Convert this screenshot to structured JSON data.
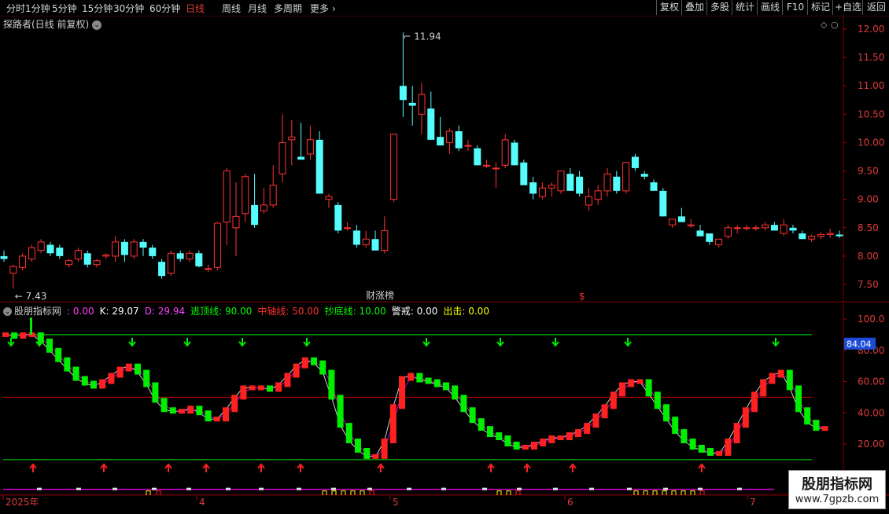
{
  "toolbar": {
    "periods": [
      "分时",
      "1分钟",
      "5分钟",
      "15分钟",
      "30分钟",
      "60分钟",
      "日线",
      "周线",
      "月线",
      "多周期",
      "更多"
    ],
    "active_period": "日线",
    "right_buttons": [
      "复权",
      "叠加",
      "多股",
      "统计",
      "画线",
      "F10",
      "标记",
      "+自选",
      "返回"
    ]
  },
  "main_chart": {
    "title": "探路者(日线 前复权)",
    "price_axis": [
      "12.00",
      "11.50",
      "11.00",
      "10.50",
      "10.00",
      "9.50",
      "9.00",
      "8.50",
      "8.00",
      "7.50"
    ],
    "high_label": "11.94",
    "low_label": "7.43",
    "marker_text": "财涨榜",
    "marker_symbol": "$"
  },
  "indicator": {
    "name": "股朋指标网",
    "values": [
      {
        "label": "",
        "value": ": 0.00",
        "color": "#ff40ff"
      },
      {
        "label": "K: ",
        "value": "29.07",
        "color": "#ffffff"
      },
      {
        "label": "D: ",
        "value": "29.94",
        "color": "#ff40ff"
      },
      {
        "label": "逃顶线: ",
        "value": "90.00",
        "color": "#00ff00"
      },
      {
        "label": "中轴线: ",
        "value": "50.00",
        "color": "#ff3030"
      },
      {
        "label": "抄底线: ",
        "value": "10.00",
        "color": "#00ff00"
      },
      {
        "label": "警戒: ",
        "value": "0.00",
        "color": "#ffffff"
      },
      {
        "label": "出击: ",
        "value": "0.00",
        "color": "#ffff00"
      }
    ],
    "axis": [
      "100.0",
      "80.00",
      "60.00",
      "40.00",
      "20.00"
    ],
    "current_tag": "84.04"
  },
  "dates": [
    "2025年",
    "4",
    "5",
    "6",
    "7"
  ],
  "watermark": {
    "line1": "股朋指标网",
    "line2": "www.7gpzb.com"
  },
  "colors": {
    "up": "#ff3232",
    "down": "#54fcfc",
    "bg": "#000000",
    "grid": "#7a0000"
  },
  "chart_data": {
    "type": "candlestick",
    "title": "探路者(日线 前复权)",
    "y_range": [
      7.3,
      12.2
    ],
    "candles": [
      [
        8.0,
        8.1,
        7.9,
        7.95
      ],
      [
        7.7,
        7.85,
        7.43,
        7.82
      ],
      [
        7.8,
        8.05,
        7.75,
        8.0
      ],
      [
        7.95,
        8.2,
        7.9,
        8.15
      ],
      [
        8.1,
        8.3,
        8.05,
        8.25
      ],
      [
        8.2,
        8.25,
        8.0,
        8.05
      ],
      [
        8.15,
        8.2,
        7.95,
        8.0
      ],
      [
        7.85,
        7.95,
        7.8,
        7.92
      ],
      [
        7.95,
        8.15,
        7.9,
        8.1
      ],
      [
        8.05,
        8.1,
        7.8,
        7.85
      ],
      [
        7.85,
        7.95,
        7.8,
        7.92
      ],
      [
        8.0,
        8.05,
        7.95,
        8.02
      ],
      [
        8.0,
        8.35,
        7.9,
        8.25
      ],
      [
        8.25,
        8.3,
        7.9,
        8.02
      ],
      [
        8.0,
        8.3,
        7.95,
        8.25
      ],
      [
        8.25,
        8.3,
        8.0,
        8.15
      ],
      [
        8.15,
        8.2,
        7.95,
        8.0
      ],
      [
        7.9,
        7.95,
        7.6,
        7.65
      ],
      [
        7.7,
        8.1,
        7.65,
        8.05
      ],
      [
        8.05,
        8.1,
        7.9,
        7.95
      ],
      [
        7.95,
        8.1,
        7.9,
        8.05
      ],
      [
        8.05,
        8.1,
        7.8,
        7.82
      ],
      [
        7.78,
        7.85,
        7.72,
        7.78
      ],
      [
        7.8,
        8.6,
        7.75,
        8.58
      ],
      [
        8.6,
        9.55,
        8.2,
        9.5
      ],
      [
        8.5,
        9.3,
        8.0,
        8.7
      ],
      [
        8.75,
        9.45,
        8.6,
        9.4
      ],
      [
        8.9,
        9.45,
        8.5,
        8.55
      ],
      [
        8.8,
        9.2,
        8.75,
        8.9
      ],
      [
        8.9,
        9.6,
        8.85,
        9.25
      ],
      [
        9.45,
        10.5,
        9.3,
        10.0
      ],
      [
        10.05,
        10.4,
        9.6,
        10.1
      ],
      [
        9.75,
        10.35,
        9.7,
        9.7
      ],
      [
        9.8,
        10.3,
        9.7,
        10.05
      ],
      [
        10.05,
        10.2,
        9.1,
        9.1
      ],
      [
        9.0,
        9.1,
        8.85,
        9.05
      ],
      [
        8.9,
        8.95,
        8.4,
        8.45
      ],
      [
        8.5,
        8.6,
        8.45,
        8.5
      ],
      [
        8.45,
        8.55,
        8.15,
        8.2
      ],
      [
        8.2,
        8.45,
        8.15,
        8.3
      ],
      [
        8.3,
        8.45,
        8.1,
        8.1
      ],
      [
        8.1,
        8.7,
        8.05,
        8.45
      ],
      [
        9.0,
        10.15,
        8.95,
        10.15
      ],
      [
        11.0,
        11.94,
        10.45,
        10.75
      ],
      [
        10.7,
        11.0,
        10.3,
        10.65
      ],
      [
        10.5,
        11.05,
        10.15,
        10.85
      ],
      [
        10.6,
        10.9,
        10.1,
        10.05
      ],
      [
        10.1,
        10.45,
        9.95,
        9.95
      ],
      [
        10.0,
        10.25,
        9.8,
        10.2
      ],
      [
        10.2,
        10.3,
        9.85,
        9.9
      ],
      [
        9.95,
        10.05,
        9.85,
        9.95
      ],
      [
        9.9,
        9.95,
        9.6,
        9.6
      ],
      [
        9.6,
        9.7,
        9.55,
        9.6
      ],
      [
        9.55,
        9.65,
        9.2,
        9.55
      ],
      [
        9.6,
        10.15,
        9.55,
        10.05
      ],
      [
        10.0,
        10.05,
        9.6,
        9.6
      ],
      [
        9.65,
        9.7,
        9.25,
        9.25
      ],
      [
        9.3,
        9.4,
        9.0,
        9.1
      ],
      [
        9.05,
        9.3,
        9.0,
        9.2
      ],
      [
        9.2,
        9.3,
        9.05,
        9.25
      ],
      [
        9.15,
        9.5,
        9.1,
        9.5
      ],
      [
        9.45,
        9.55,
        9.15,
        9.15
      ],
      [
        9.4,
        9.5,
        9.05,
        9.1
      ],
      [
        8.9,
        9.2,
        8.8,
        9.05
      ],
      [
        9.0,
        9.25,
        8.9,
        9.15
      ],
      [
        9.15,
        9.55,
        9.05,
        9.45
      ],
      [
        9.4,
        9.5,
        9.1,
        9.15
      ],
      [
        9.15,
        9.65,
        9.1,
        9.65
      ],
      [
        9.75,
        9.8,
        9.5,
        9.55
      ],
      [
        9.45,
        9.5,
        9.35,
        9.4
      ],
      [
        9.3,
        9.35,
        9.15,
        9.15
      ],
      [
        9.15,
        9.2,
        8.7,
        8.7
      ],
      [
        8.55,
        8.65,
        8.5,
        8.65
      ],
      [
        8.7,
        8.85,
        8.6,
        8.6
      ],
      [
        8.55,
        8.65,
        8.5,
        8.55
      ],
      [
        8.45,
        8.55,
        8.35,
        8.35
      ],
      [
        8.4,
        8.4,
        8.2,
        8.25
      ],
      [
        8.2,
        8.3,
        8.15,
        8.3
      ],
      [
        8.35,
        8.55,
        8.3,
        8.5
      ],
      [
        8.5,
        8.55,
        8.4,
        8.5
      ],
      [
        8.5,
        8.55,
        8.45,
        8.5
      ],
      [
        8.5,
        8.55,
        8.45,
        8.5
      ],
      [
        8.5,
        8.6,
        8.45,
        8.55
      ],
      [
        8.55,
        8.6,
        8.45,
        8.45
      ],
      [
        8.4,
        8.65,
        8.35,
        8.55
      ],
      [
        8.5,
        8.55,
        8.4,
        8.45
      ],
      [
        8.4,
        8.45,
        8.3,
        8.3
      ],
      [
        8.3,
        8.38,
        8.25,
        8.35
      ],
      [
        8.35,
        8.42,
        8.3,
        8.38
      ],
      [
        8.38,
        8.48,
        8.32,
        8.4
      ],
      [
        8.38,
        8.45,
        8.32,
        8.35
      ]
    ]
  }
}
